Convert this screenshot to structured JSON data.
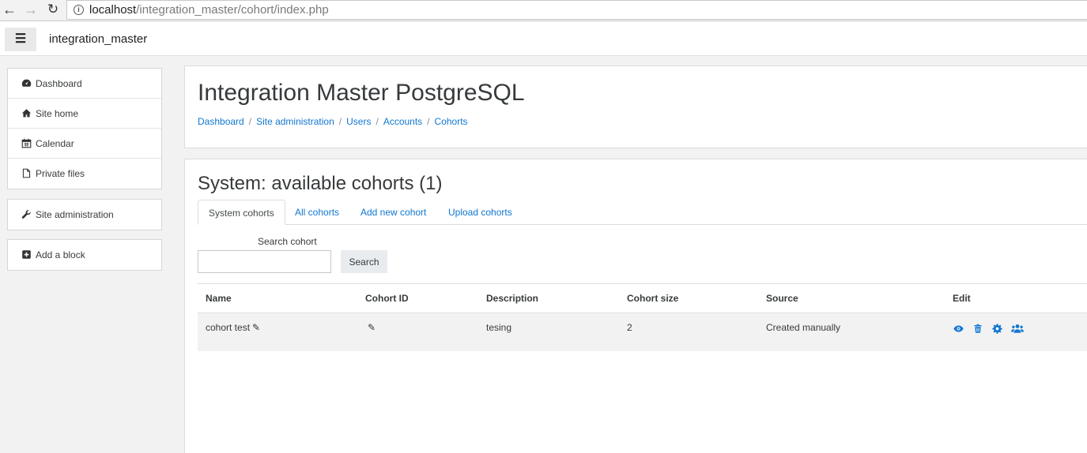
{
  "browser": {
    "url_host": "localhost",
    "url_path": "/integration_master/cohort/index.php"
  },
  "navbar": {
    "site_name": "integration_master"
  },
  "sidebar": {
    "nav": [
      {
        "label": "Dashboard",
        "icon": "dashboard-icon"
      },
      {
        "label": "Site home",
        "icon": "home-icon"
      },
      {
        "label": "Calendar",
        "icon": "calendar-icon"
      },
      {
        "label": "Private files",
        "icon": "file-icon"
      }
    ],
    "admin": {
      "label": "Site administration",
      "icon": "wrench-icon"
    },
    "add_block": {
      "label": "Add a block",
      "icon": "plus-square-icon"
    }
  },
  "header": {
    "title": "Integration Master PostgreSQL",
    "breadcrumb": [
      "Dashboard",
      "Site administration",
      "Users",
      "Accounts",
      "Cohorts"
    ]
  },
  "content": {
    "heading": "System: available cohorts (1)",
    "tabs": [
      "System cohorts",
      "All cohorts",
      "Add new cohort",
      "Upload cohorts"
    ],
    "active_tab": 0,
    "search": {
      "label": "Search cohort",
      "value": "",
      "button": "Search"
    },
    "table": {
      "columns": [
        "Name",
        "Cohort ID",
        "Description",
        "Cohort size",
        "Source",
        "Edit"
      ],
      "rows": [
        {
          "name": "cohort test",
          "cohort_id": "",
          "description": "tesing",
          "size": "2",
          "source": "Created manually"
        }
      ]
    }
  },
  "colors": {
    "link": "#1177d1",
    "row_bg": "#f2f2f2"
  }
}
